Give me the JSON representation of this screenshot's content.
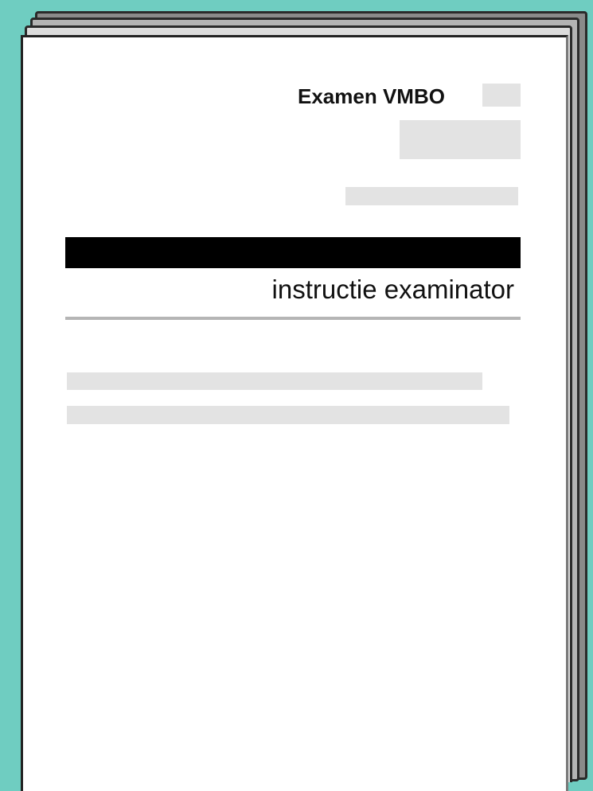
{
  "document": {
    "title": "Examen VMBO",
    "subtitle": "instructie examinator"
  },
  "colors": {
    "background": "#6fcdc1",
    "page": "#ffffff",
    "band": "#000000",
    "placeholder": "#e3e3e3",
    "divider": "#b5b5b5"
  }
}
